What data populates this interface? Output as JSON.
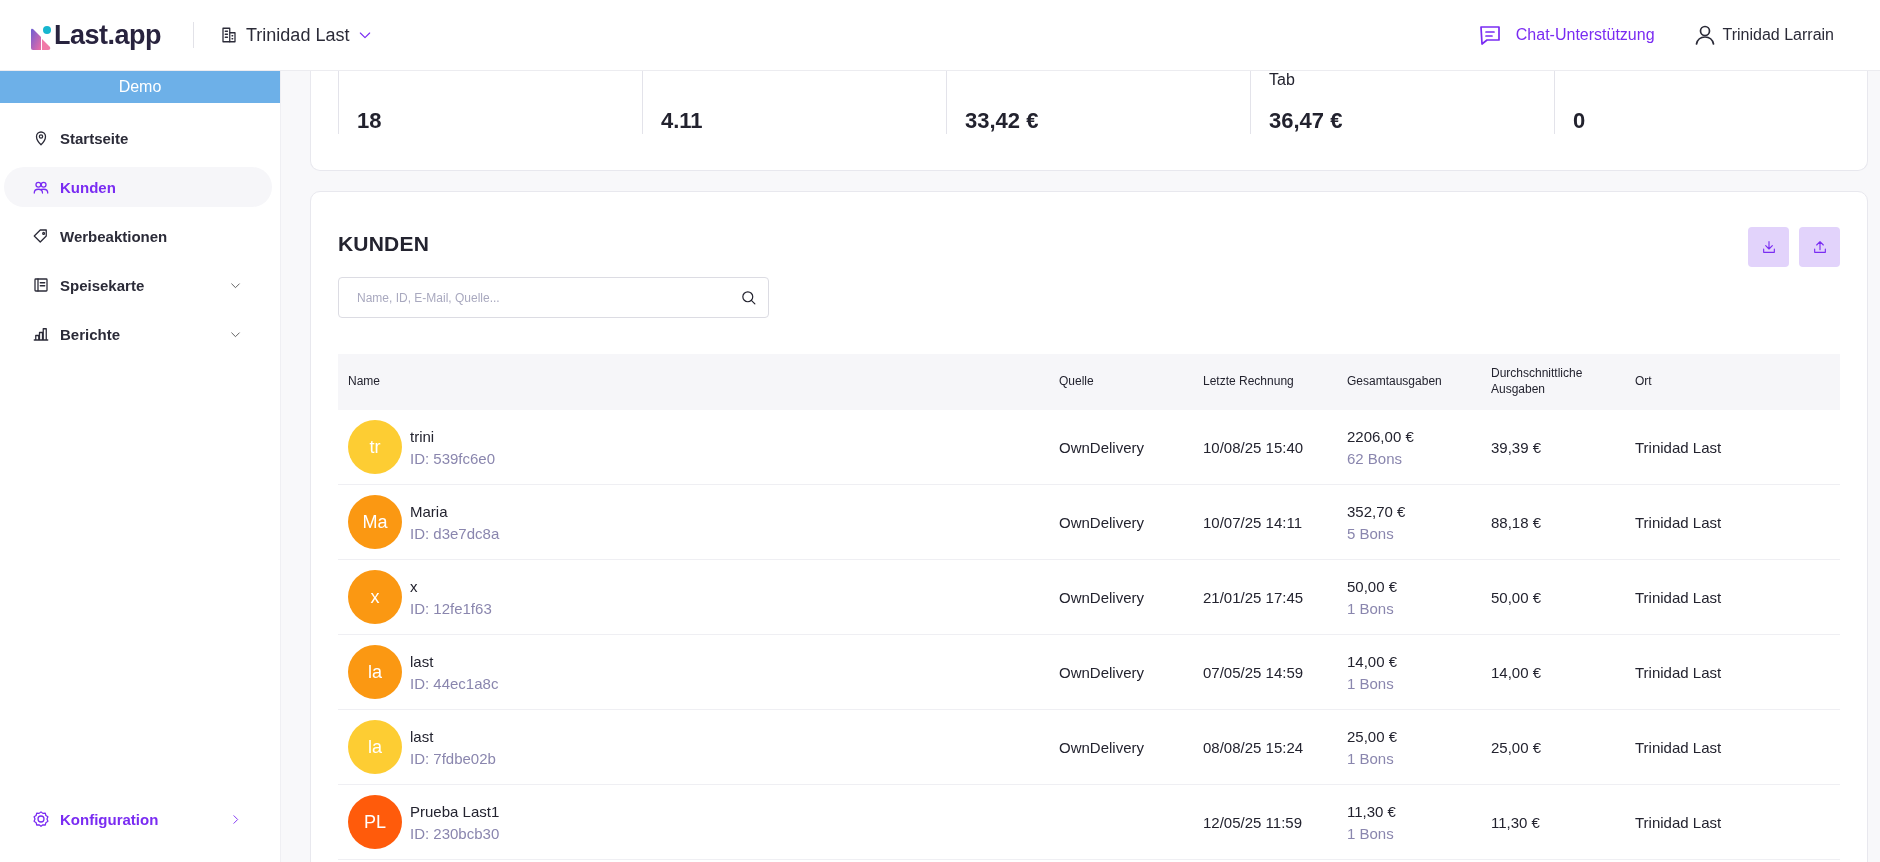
{
  "header": {
    "logo": "Last.app",
    "location": "Trinidad Last",
    "chat": "Chat-Unterstützung",
    "user": "Trinidad Larrain"
  },
  "sidebar": {
    "banner": "Demo",
    "items": [
      {
        "label": "Startseite",
        "selected": false,
        "expandable": false
      },
      {
        "label": "Kunden",
        "selected": true,
        "expandable": false
      },
      {
        "label": "Werbeaktionen",
        "selected": false,
        "expandable": false
      },
      {
        "label": "Speisekarte",
        "selected": false,
        "expandable": true
      },
      {
        "label": "Berichte",
        "selected": false,
        "expandable": true
      }
    ],
    "footer": {
      "label": "Konfiguration"
    }
  },
  "stats": [
    {
      "value": "18"
    },
    {
      "value": "4.11"
    },
    {
      "value": "33,42 €"
    },
    {
      "label": "Tab",
      "value": "36,47 €"
    },
    {
      "value": "0"
    }
  ],
  "customers": {
    "title": "KUNDEN",
    "search": {
      "placeholder": "Name, ID, E-Mail, Quelle..."
    },
    "columns": [
      "Name",
      "Quelle",
      "Letzte Rechnung",
      "Gesamtausgaben",
      "Durchschnittliche Ausgaben",
      "Ort"
    ],
    "rows": [
      {
        "initials": "tr",
        "color": "#fdcd33",
        "name": "trini",
        "id": "ID: 539fc6e0",
        "source": "OwnDelivery",
        "last_invoice": "10/08/25 15:40",
        "total": "2206,00 €",
        "bons": "62 Bons",
        "average": "39,39 €",
        "place": "Trinidad Last"
      },
      {
        "initials": "Ma",
        "color": "#fb9812",
        "name": "Maria",
        "id": "ID: d3e7dc8a",
        "source": "OwnDelivery",
        "last_invoice": "10/07/25 14:11",
        "total": "352,70 €",
        "bons": "5 Bons",
        "average": "88,18 €",
        "place": "Trinidad Last"
      },
      {
        "initials": "x",
        "color": "#fb9812",
        "name": "x",
        "id": "ID: 12fe1f63",
        "source": "OwnDelivery",
        "last_invoice": "21/01/25 17:45",
        "total": "50,00 €",
        "bons": "1 Bons",
        "average": "50,00 €",
        "place": "Trinidad Last"
      },
      {
        "initials": "la",
        "color": "#fb9812",
        "name": "last",
        "id": "ID: 44ec1a8c",
        "source": "OwnDelivery",
        "last_invoice": "07/05/25 14:59",
        "total": "14,00 €",
        "bons": "1 Bons",
        "average": "14,00 €",
        "place": "Trinidad Last"
      },
      {
        "initials": "la",
        "color": "#fdcd33",
        "name": "last",
        "id": "ID: 7fdbe02b",
        "source": "OwnDelivery",
        "last_invoice": "08/08/25 15:24",
        "total": "25,00 €",
        "bons": "1 Bons",
        "average": "25,00 €",
        "place": "Trinidad Last"
      },
      {
        "initials": "PL",
        "color": "#ff5b0b",
        "name": "Prueba Last1",
        "id": "ID: 230bcb30",
        "last_invoice": "12/05/25 11:59",
        "total": "11,30 €",
        "bons": "1 Bons",
        "average": "11,30 €",
        "place": "Trinidad Last"
      }
    ]
  }
}
